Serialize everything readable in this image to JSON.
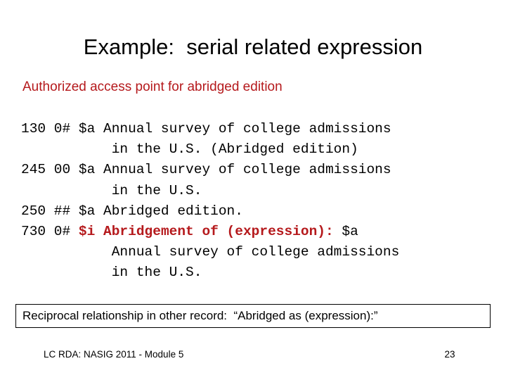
{
  "slide": {
    "title": "Example:  serial related expression",
    "subheading": "Authorized access point for abridged edition",
    "accent_color": "#B5191C",
    "text_color": "#000000",
    "background_color": "#FFFFFF"
  },
  "marc_record": {
    "lines": [
      {
        "tag": "130",
        "indicators": "0#",
        "segments": [
          {
            "text": "130 0# $a Annual survey of college admissions",
            "color": "black",
            "bold": false
          }
        ]
      },
      {
        "tag": "",
        "indicators": "",
        "segments": [
          {
            "text": "           in the U.S. (Abridged edition)",
            "color": "black",
            "bold": false
          }
        ]
      },
      {
        "tag": "245",
        "indicators": "00",
        "segments": [
          {
            "text": "245 00 $a Annual survey of college admissions",
            "color": "black",
            "bold": false
          }
        ]
      },
      {
        "tag": "",
        "indicators": "",
        "segments": [
          {
            "text": "           in the U.S.",
            "color": "black",
            "bold": false
          }
        ]
      },
      {
        "tag": "250",
        "indicators": "##",
        "segments": [
          {
            "text": "250 ## $a Abridged edition.",
            "color": "black",
            "bold": false
          }
        ]
      },
      {
        "tag": "730",
        "indicators": "0#",
        "segments": [
          {
            "text": "730 0# ",
            "color": "black",
            "bold": false
          },
          {
            "text": "$i Abridgement of (expression):",
            "color": "red",
            "bold": true
          },
          {
            "text": " $a",
            "color": "black",
            "bold": false
          }
        ]
      },
      {
        "tag": "",
        "indicators": "",
        "segments": [
          {
            "text": "           Annual survey of college admissions",
            "color": "black",
            "bold": false
          }
        ]
      },
      {
        "tag": "",
        "indicators": "",
        "segments": [
          {
            "text": "           in the U.S.",
            "color": "black",
            "bold": false
          }
        ]
      }
    ]
  },
  "callout": {
    "text": "Reciprocal relationship in other record:  “Abridged as (expression):”"
  },
  "footer": {
    "source": "LC RDA: NASIG 2011 - Module 5",
    "page_number": "23"
  }
}
